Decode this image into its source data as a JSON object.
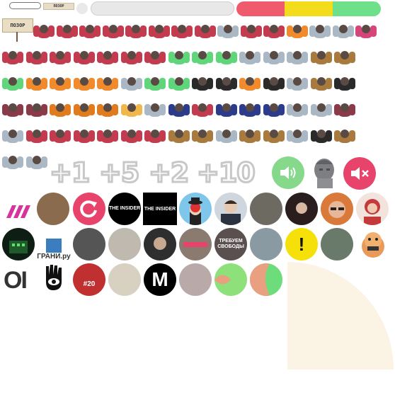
{
  "top": {
    "tag_label": "ПОЗОР",
    "tri_colors": [
      "#ef5a6c",
      "#f3dc1b",
      "#6fe08a"
    ]
  },
  "sign": {
    "label": "ПОЗОР"
  },
  "figures": {
    "rows": [
      [
        "#c23b4e",
        "#c23b4e",
        "#c23b4e",
        "#c23b4e",
        "#c23b4e",
        "#c23b4e",
        "#c23b4e",
        "#c23b4e",
        "#aab7c4",
        "#c23b4e",
        "#c23b4e",
        "#f08a2a",
        "#aab7c4",
        "#aab7c4",
        "#d6457a"
      ],
      [
        "#c23b4e",
        "#c23b4e",
        "#c23b4e",
        "#c23b4e",
        "#c23b4e",
        "#c23b4e",
        "#c23b4e",
        "#5fd67a",
        "#5fd67a",
        "#5fd67a",
        "#aab7c4",
        "#aab7c4",
        "#aab7c4",
        "#a87a3e",
        "#a87a3e"
      ],
      [
        "#5fd67a",
        "#f08a2a",
        "#f08a2a",
        "#f08a2a",
        "#f08a2a",
        "#aab7c4",
        "#5fd67a",
        "#5fd67a",
        "#2a2a2a",
        "#2a2a2a",
        "#f08a2a",
        "#2a2a2a",
        "#aab7c4",
        "#a87a3e",
        "#2a2a2a"
      ],
      [
        "#8b3a4a",
        "#8b3a4a",
        "#e07b1e",
        "#e07b1e",
        "#e07b1e",
        "#f0b84a",
        "#aab7c4",
        "#2c3b8c",
        "#c23b4e",
        "#2c3b8c",
        "#2c3b8c",
        "#2c3b8c",
        "#aab7c4",
        "#aab7c4",
        "#8b3a4a"
      ],
      [
        "#aab7c4",
        "#c23b4e",
        "#c23b4e",
        "#c23b4e",
        "#c23b4e",
        "#c23b4e",
        "#c23b4e",
        "#a87a3e",
        "#a87a3e",
        "#aab7c4",
        "#a87a3e",
        "#a87a3e",
        "#aab7c4",
        "#2a2a2a",
        "#a87a3e"
      ],
      [
        "#aab7c4",
        "#aab7c4"
      ]
    ]
  },
  "counters": [
    "+1",
    "+5",
    "+2",
    "+10"
  ],
  "buttons": {
    "sound_on_color": "#86d98a",
    "mute_color": "#e8446b",
    "refresh_color": "#e8446b"
  },
  "avatars": {
    "row1": [
      {
        "name": "rain-logo",
        "bg": "#ffffff",
        "text": ""
      },
      {
        "name": "bearded-man",
        "bg": "#8b6b4e",
        "text": ""
      },
      {
        "name": "refresh-logo",
        "bg": "#e8446b",
        "text": ""
      },
      {
        "name": "the-insider-1",
        "bg": "#000000",
        "text": "THE INSIDER"
      },
      {
        "name": "the-insider-2",
        "bg": "#000000",
        "text": "THE INSIDER"
      },
      {
        "name": "bowler-hat",
        "bg": "#7ec7ea",
        "text": ""
      },
      {
        "name": "man-suit",
        "bg": "#cfd6dd",
        "text": ""
      },
      {
        "name": "group-photo",
        "bg": "#6d6a62",
        "text": ""
      },
      {
        "name": "woman-dark",
        "bg": "#2a1d1d",
        "text": ""
      },
      {
        "name": "man-glasses",
        "bg": "#d9793a",
        "text": ""
      },
      {
        "name": "woman-red",
        "bg": "#c43a3a",
        "text": ""
      }
    ],
    "row2": [
      {
        "name": "green-building",
        "bg": "#0f1e14",
        "text": ""
      },
      {
        "name": "grani-logo",
        "bg": "#ffffff",
        "text": "ГРАНИ.ру"
      },
      {
        "name": "man-bw",
        "bg": "#555555",
        "text": ""
      },
      {
        "name": "tied-figure",
        "bg": "#bfb9b0",
        "text": ""
      },
      {
        "name": "man-dark",
        "bg": "#2e2e2e",
        "text": ""
      },
      {
        "name": "masked-man",
        "bg": "#8a7a70",
        "text": ""
      },
      {
        "name": "protest-sign",
        "bg": "#5a5050",
        "text": "ТРЕБУЕМ СВОБОДЫ"
      },
      {
        "name": "outdoor-man",
        "bg": "#8a9aa3",
        "text": ""
      },
      {
        "name": "alert-yellow",
        "bg": "#f5e00a",
        "text": "!"
      },
      {
        "name": "man-outdoor-2",
        "bg": "#6a7a6a",
        "text": ""
      },
      {
        "name": "cartoon-pig",
        "bg": "#ffffff",
        "text": ""
      }
    ],
    "row3": [
      {
        "name": "oi-logo",
        "bg": "#ffffff",
        "text": "OI"
      },
      {
        "name": "hand-eye-logo",
        "bg": "#ffffff",
        "text": ""
      },
      {
        "name": "number-20",
        "bg": "#c03030",
        "text": "#20"
      },
      {
        "name": "graffiti",
        "bg": "#d8d0c0",
        "text": ""
      },
      {
        "name": "m-logo",
        "bg": "#000000",
        "text": "M"
      },
      {
        "name": "woman-light",
        "bg": "#b9a9a9",
        "text": ""
      },
      {
        "name": "green-half-1",
        "bg": "#8ee07a",
        "text": ""
      },
      {
        "name": "green-half-2",
        "bg": "#6ddc7a",
        "text": ""
      }
    ]
  },
  "quarter_color": "#fbf3e4"
}
